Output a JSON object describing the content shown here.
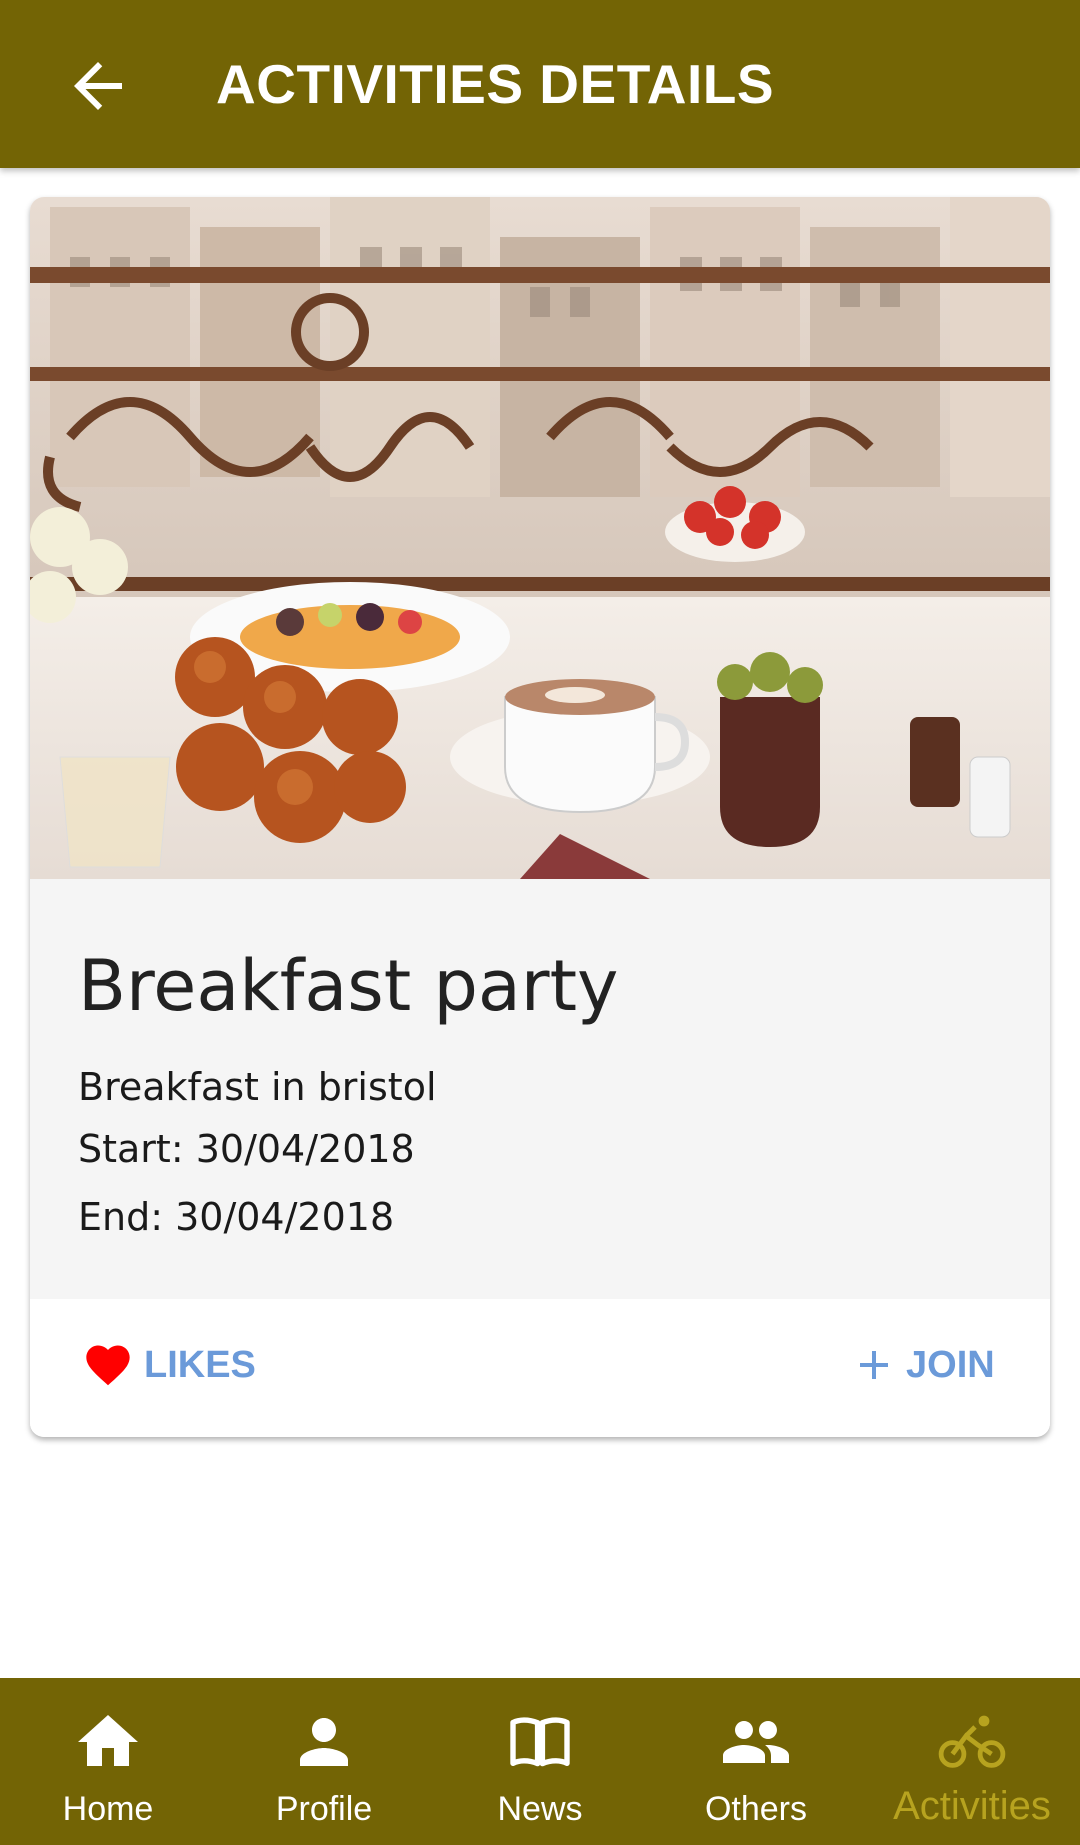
{
  "colors": {
    "primary": "#736405",
    "accent_link": "#6b9ad9",
    "heart": "#ff0000",
    "active_nav": "#b7a31f"
  },
  "appbar": {
    "title": "ACTIVITIES DETAILS",
    "back_icon": "arrow-left-icon"
  },
  "activity": {
    "title": "Breakfast party",
    "description": "Breakfast in bristol",
    "start": "Start: 30/04/2018",
    "end": "End: 30/04/2018",
    "image": "breakfast-table-balcony-photo"
  },
  "actions": {
    "likes_label": "LIKES",
    "likes_icon": "heart-icon",
    "join_label": "JOIN",
    "join_icon": "plus-icon"
  },
  "bottom_nav": {
    "items": [
      {
        "label": "Home",
        "icon": "home-icon"
      },
      {
        "label": "Profile",
        "icon": "person-icon"
      },
      {
        "label": "News",
        "icon": "book-icon"
      },
      {
        "label": "Others",
        "icon": "people-icon"
      },
      {
        "label": "Activities",
        "icon": "bike-icon"
      }
    ],
    "active": "Activities"
  }
}
